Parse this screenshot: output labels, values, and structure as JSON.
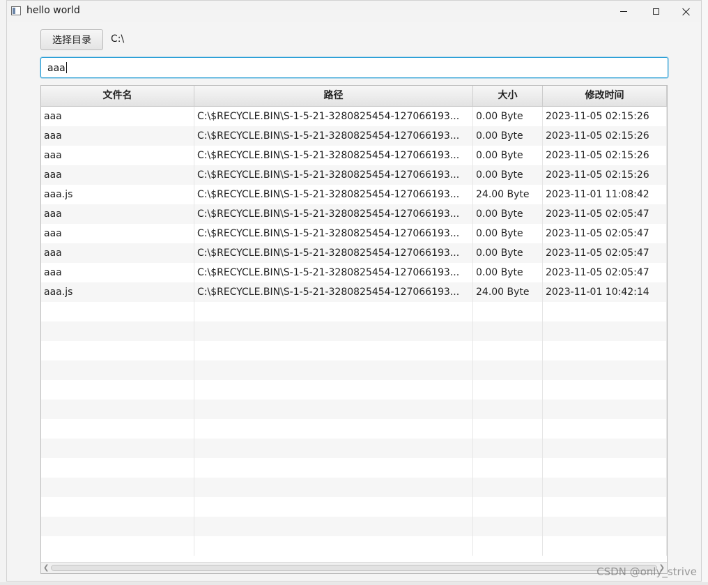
{
  "window": {
    "title": "hello world"
  },
  "toolbar": {
    "choose_dir_label": "选择目录",
    "current_dir": "C:\\"
  },
  "search": {
    "value": "aaa"
  },
  "table": {
    "columns": [
      "文件名",
      "路径",
      "大小",
      "修改时间"
    ],
    "rows": [
      [
        "aaa",
        "C:\\$RECYCLE.BIN\\S-1-5-21-3280825454-127066193...",
        "0.00 Byte",
        "2023-11-05 02:15:26"
      ],
      [
        "aaa",
        "C:\\$RECYCLE.BIN\\S-1-5-21-3280825454-127066193...",
        "0.00 Byte",
        "2023-11-05 02:15:26"
      ],
      [
        "aaa",
        "C:\\$RECYCLE.BIN\\S-1-5-21-3280825454-127066193...",
        "0.00 Byte",
        "2023-11-05 02:15:26"
      ],
      [
        "aaa",
        "C:\\$RECYCLE.BIN\\S-1-5-21-3280825454-127066193...",
        "0.00 Byte",
        "2023-11-05 02:15:26"
      ],
      [
        "aaa.js",
        "C:\\$RECYCLE.BIN\\S-1-5-21-3280825454-127066193...",
        "24.00 Byte",
        "2023-11-01 11:08:42"
      ],
      [
        "aaa",
        "C:\\$RECYCLE.BIN\\S-1-5-21-3280825454-127066193...",
        "0.00 Byte",
        "2023-11-05 02:05:47"
      ],
      [
        "aaa",
        "C:\\$RECYCLE.BIN\\S-1-5-21-3280825454-127066193...",
        "0.00 Byte",
        "2023-11-05 02:05:47"
      ],
      [
        "aaa",
        "C:\\$RECYCLE.BIN\\S-1-5-21-3280825454-127066193...",
        "0.00 Byte",
        "2023-11-05 02:05:47"
      ],
      [
        "aaa",
        "C:\\$RECYCLE.BIN\\S-1-5-21-3280825454-127066193...",
        "0.00 Byte",
        "2023-11-05 02:05:47"
      ],
      [
        "aaa.js",
        "C:\\$RECYCLE.BIN\\S-1-5-21-3280825454-127066193...",
        "24.00 Byte",
        "2023-11-01 10:42:14"
      ]
    ]
  },
  "watermark": "CSDN @only_strive",
  "colors": {
    "focus_border": "#2a9fd6",
    "row_alt": "#f6f6f6"
  }
}
